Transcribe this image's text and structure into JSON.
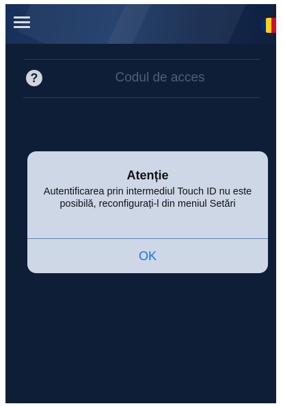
{
  "header": {
    "menu_icon": "hamburger-menu-icon",
    "language_flag": {
      "icon": "romanian-flag-icon",
      "colors": [
        "#002B7F",
        "#FCD116",
        "#CE1126"
      ]
    }
  },
  "login": {
    "help_icon": "question-mark-icon",
    "help_glyph": "?",
    "access_code_placeholder": "Codul de acces"
  },
  "alert": {
    "title": "Atenție",
    "message": "Autentificarea prin intermediul Touch ID nu este posibilă, reconfigurați-l din meniul Setări",
    "ok_label": "OK"
  },
  "colors": {
    "background": "#0e1e36",
    "alert_background": "#cdd7e6",
    "ok_blue": "#1a73e8"
  }
}
